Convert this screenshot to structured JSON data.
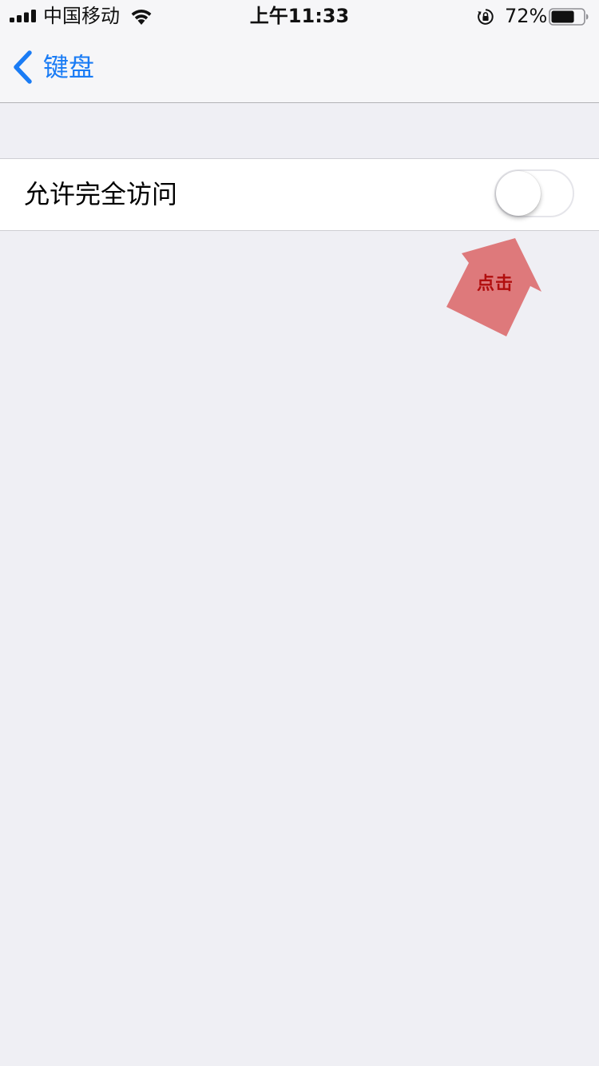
{
  "status_bar": {
    "carrier": "中国移动",
    "time": "上午11:33",
    "battery_percent": "72%",
    "battery_level": 0.72,
    "icons": [
      "signal-icon",
      "wifi-icon",
      "rotation-lock-icon",
      "battery-icon"
    ]
  },
  "nav": {
    "back_label": "键盘",
    "back_icon": "chevron-left-icon",
    "accent_color": "#1a7cf5"
  },
  "settings": {
    "full_access_label": "允许完全访问",
    "full_access_enabled": false
  },
  "annotation": {
    "label": "点击",
    "color": "#dc6c6e"
  }
}
